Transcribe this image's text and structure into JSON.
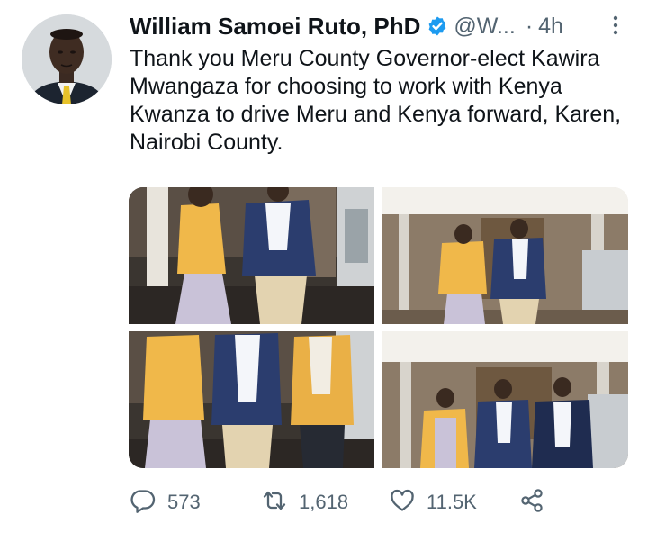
{
  "tweet": {
    "author_name": "William Samoei Ruto, PhD",
    "handle": "@W...",
    "separator": "·",
    "time": "4h",
    "text": "Thank you Meru County Governor-elect Kawira Mwangaza for choosing to work with Kenya Kwanza to drive Meru and Kenya forward, Karen, Nairobi County."
  },
  "icons": {
    "verified": "verified-badge-icon",
    "more": "more-options-icon",
    "reply": "reply-icon",
    "retweet": "retweet-icon",
    "like": "like-icon",
    "share": "share-icon"
  },
  "stats": {
    "replies": "573",
    "retweets": "1,618",
    "likes": "11.5K"
  },
  "colors": {
    "verified_blue": "#1d9bf0",
    "secondary_text": "#536471",
    "primary_text": "#0f1419"
  }
}
